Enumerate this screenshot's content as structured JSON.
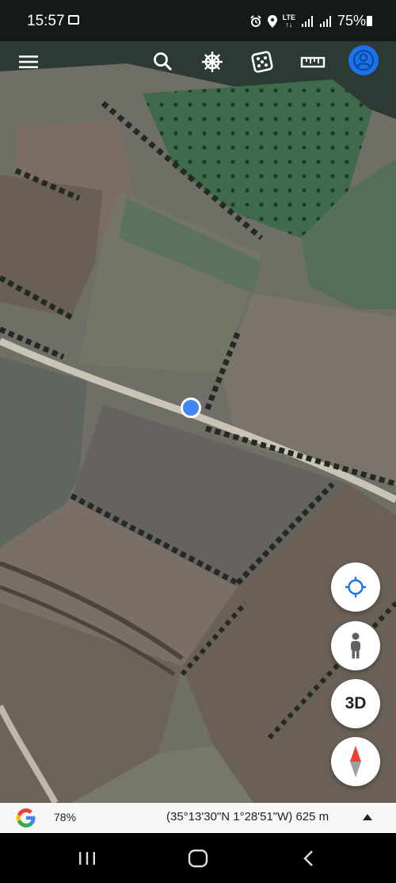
{
  "status_bar": {
    "time": "15:57",
    "battery_text": "75%",
    "lte_label": "LTE",
    "icons": [
      "gallery-icon",
      "alarm-icon",
      "location-icon",
      "lte-icon",
      "signal-icon",
      "signal-icon",
      "battery-icon"
    ]
  },
  "toolbar": {
    "buttons": [
      {
        "name": "menu",
        "icon": "menu-icon"
      },
      {
        "name": "search",
        "icon": "search-icon"
      },
      {
        "name": "voyager",
        "icon": "ship-wheel-icon"
      },
      {
        "name": "feeling-lucky",
        "icon": "dice-icon"
      },
      {
        "name": "measure",
        "icon": "ruler-icon"
      },
      {
        "name": "account",
        "icon": "account-icon"
      }
    ]
  },
  "map_controls": {
    "locate_icon": "crosshair-icon",
    "street_view_icon": "pegman-icon",
    "view_3d_label": "3D",
    "compass_icon": "compass-icon"
  },
  "info_bar": {
    "logo": "google-g-logo",
    "zoom_percent": "78%",
    "coordinates": "(35°13'30\"N 1°28'51\"W) 625 m",
    "expand_icon": "caret-up-icon"
  },
  "nav_bar": {
    "buttons": [
      {
        "name": "recents",
        "icon": "recents-icon"
      },
      {
        "name": "home",
        "icon": "home-icon"
      },
      {
        "name": "back",
        "icon": "back-icon"
      }
    ]
  },
  "colors": {
    "accent": "#1a73e8",
    "location_dot": "#4285f4",
    "compass_red": "#ea4335"
  }
}
